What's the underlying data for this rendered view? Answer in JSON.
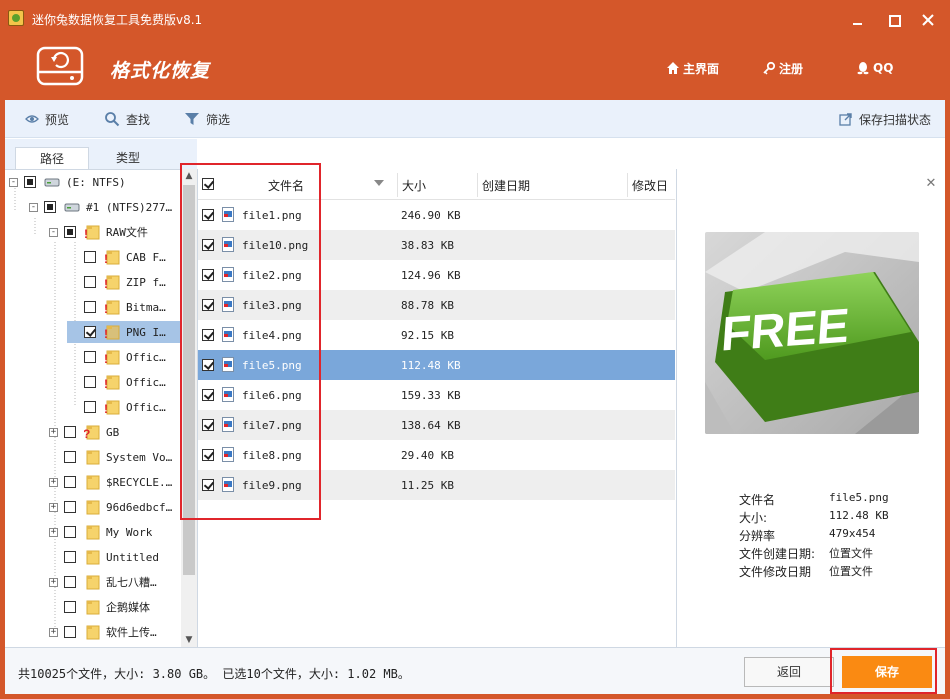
{
  "window": {
    "title": "迷你兔数据恢复工具免费版v8.1",
    "accent_color": "#d4572a",
    "controls": [
      "minimize",
      "maximize",
      "close"
    ]
  },
  "header": {
    "mode_title": "格式化恢复",
    "links": {
      "home": "主界面",
      "register": "注册",
      "qq": "QQ"
    }
  },
  "toolbar": {
    "preview": "预览",
    "find": "查找",
    "filter": "筛选",
    "save_scan": "保存扫描状态"
  },
  "left_tabs": {
    "path": "路径",
    "type": "类型"
  },
  "tree": {
    "items": [
      {
        "label": "(E: NTFS)",
        "level": 0,
        "expander": "-",
        "check": "partial",
        "icon": "drive-icon"
      },
      {
        "label": "#1 (NTFS)277…",
        "level": 1,
        "expander": "-",
        "check": "partial",
        "icon": "drive-icon"
      },
      {
        "label": "RAW文件",
        "level": 2,
        "expander": "-",
        "check": "partial",
        "icon": "folder-warning-icon"
      },
      {
        "label": "CAB F…",
        "level": 3,
        "expander": "",
        "check": "none",
        "icon": "folder-warning-icon"
      },
      {
        "label": "ZIP f…",
        "level": 3,
        "expander": "",
        "check": "none",
        "icon": "folder-warning-icon"
      },
      {
        "label": "Bitma…",
        "level": 3,
        "expander": "",
        "check": "none",
        "icon": "folder-warning-icon"
      },
      {
        "label": "PNG I…",
        "level": 3,
        "expander": "",
        "check": "checked",
        "icon": "folder-warning-icon",
        "selected": true
      },
      {
        "label": "Offic…",
        "level": 3,
        "expander": "",
        "check": "none",
        "icon": "folder-warning-icon"
      },
      {
        "label": "Offic…",
        "level": 3,
        "expander": "",
        "check": "none",
        "icon": "folder-warning-icon"
      },
      {
        "label": "Offic…",
        "level": 3,
        "expander": "",
        "check": "none",
        "icon": "folder-warning-icon"
      },
      {
        "label": "GB",
        "level": 2,
        "expander": "+",
        "check": "none",
        "icon": "folder-question-icon"
      },
      {
        "label": "System Vo…",
        "level": 2,
        "expander": "",
        "check": "none",
        "icon": "folder-icon"
      },
      {
        "label": "$RECYCLE.…",
        "level": 2,
        "expander": "+",
        "check": "none",
        "icon": "folder-icon"
      },
      {
        "label": "96d6edbcf…",
        "level": 2,
        "expander": "+",
        "check": "none",
        "icon": "folder-icon"
      },
      {
        "label": "My Work",
        "level": 2,
        "expander": "+",
        "check": "none",
        "icon": "folder-icon"
      },
      {
        "label": "Untitled",
        "level": 2,
        "expander": "",
        "check": "none",
        "icon": "folder-icon"
      },
      {
        "label": "乱七八糟…",
        "level": 2,
        "expander": "+",
        "check": "none",
        "icon": "folder-icon"
      },
      {
        "label": "企鹅媒体",
        "level": 2,
        "expander": "",
        "check": "none",
        "icon": "folder-icon"
      },
      {
        "label": "软件上传…",
        "level": 2,
        "expander": "+",
        "check": "none",
        "icon": "folder-icon"
      }
    ]
  },
  "file_list": {
    "columns": {
      "name": "文件名",
      "size": "大小",
      "created": "创建日期",
      "modified": "修改日"
    },
    "rows": [
      {
        "name": "file1.png",
        "size": "246.90 KB"
      },
      {
        "name": "file10.png",
        "size": "38.83 KB"
      },
      {
        "name": "file2.png",
        "size": "124.96 KB"
      },
      {
        "name": "file3.png",
        "size": "88.78 KB"
      },
      {
        "name": "file4.png",
        "size": "92.15 KB"
      },
      {
        "name": "file5.png",
        "size": "112.48 KB",
        "selected": true
      },
      {
        "name": "file6.png",
        "size": "159.33 KB"
      },
      {
        "name": "file7.png",
        "size": "138.64 KB"
      },
      {
        "name": "file8.png",
        "size": "29.40 KB"
      },
      {
        "name": "file9.png",
        "size": "11.25 KB"
      }
    ]
  },
  "preview": {
    "image_text": "FREE",
    "info": [
      {
        "label": "文件名",
        "value": "file5.png"
      },
      {
        "label": "大小:",
        "value": "112.48 KB"
      },
      {
        "label": "分辨率",
        "value": "479x454"
      },
      {
        "label": "文件创建日期:",
        "value": "位置文件"
      },
      {
        "label": "文件修改日期",
        "value": "位置文件"
      }
    ]
  },
  "footer": {
    "status": "共10025个文件，大小: 3.80 GB。 已选10个文件，大小: 1.02 MB。",
    "back": "返回",
    "save": "保存",
    "save_color": "#fa8a12"
  }
}
